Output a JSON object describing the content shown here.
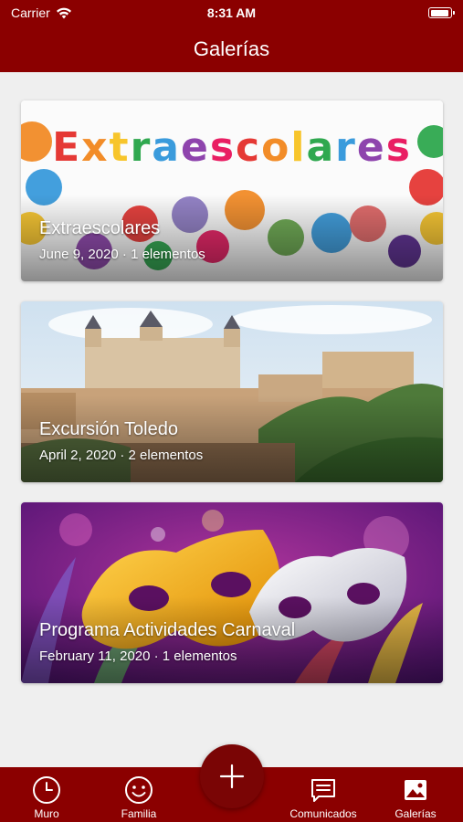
{
  "status_bar": {
    "carrier": "Carrier",
    "time": "8:31 AM"
  },
  "header": {
    "title": "Galerías"
  },
  "galleries": [
    {
      "title": "Extraescolares",
      "meta": "June 9, 2020 · 1 elementos",
      "art_text": "Extraescolares"
    },
    {
      "title": "Excursión Toledo",
      "meta": "April 2, 2020 · 2 elementos"
    },
    {
      "title": "Programa Actividades Carnaval",
      "meta": "February 11, 2020 · 1 elementos"
    }
  ],
  "tab_bar": {
    "items": [
      {
        "label": "Muro",
        "icon": "clock-icon"
      },
      {
        "label": "Familia",
        "icon": "smiley-icon"
      },
      {
        "label": "Comunicados",
        "icon": "message-icon"
      },
      {
        "label": "Galerías",
        "icon": "image-icon"
      }
    ],
    "fab_icon": "plus-icon"
  },
  "colors": {
    "brand": "#8b0000",
    "background": "#efefef",
    "fab": "#7a0505"
  }
}
